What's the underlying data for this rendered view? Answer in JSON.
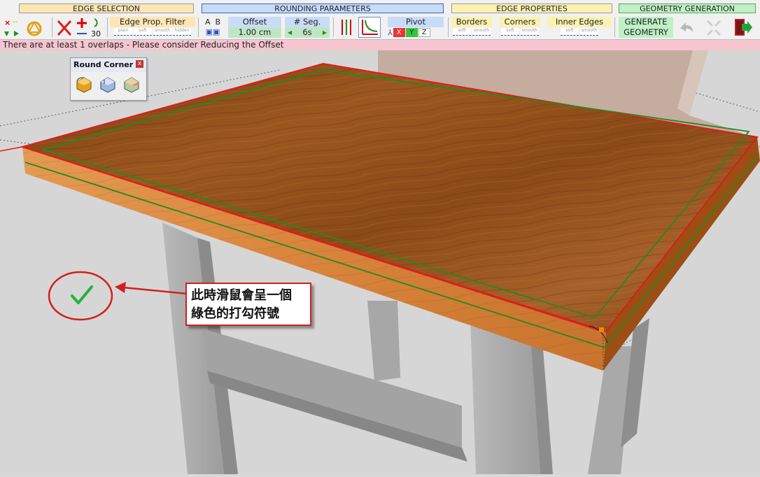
{
  "sections": {
    "edge_selection": "EDGE SELECTION",
    "rounding_parameters": "ROUNDING PARAMETERS",
    "edge_properties": "EDGE PROPERTIES",
    "geometry_generation": "GEOMETRY GENERATION"
  },
  "toolbar": {
    "angle_value": "30",
    "edge_prop_filter": "Edge Prop. Filter",
    "filter_options": [
      "plain",
      "soft",
      "smooth",
      "hidden"
    ],
    "ab_a": "A",
    "ab_b": "B",
    "offset_label": "Offset",
    "offset_value": "1.00 cm",
    "seg_label": "# Seg.",
    "seg_value": "6s",
    "pivot_label": "Pivot",
    "pivot_x": "X",
    "pivot_y": "Y",
    "pivot_z": "Z",
    "borders_label": "Borders",
    "corners_label": "Corners",
    "inner_edges_label": "Inner Edges",
    "prop_options": [
      "soft",
      "smooth"
    ],
    "generate_line1": "GENERATE",
    "generate_line2": "GEOMETRY"
  },
  "status_message": "There are at least 1 overlaps - Please consider Reducing the Offset",
  "palette": {
    "title": "Round Corner",
    "close": "x"
  },
  "callout": {
    "line1": "此時滑鼠會呈一個",
    "line2": "綠色的打勾符號"
  },
  "colors": {
    "edge_selection_bg": "#fde6b3",
    "rounding_bg": "#c9dcf7",
    "edge_props_bg": "#fbf2b2",
    "geometry_bg": "#bff0c6",
    "status_bg": "#f6c5d0",
    "selection_red": "#e11b1b",
    "offset_green": "#1f8c1f"
  },
  "icons": [
    "delete-selection-icon",
    "move-icon",
    "round-corner-icon",
    "bevel-icon",
    "chamfer-icon",
    "undo-icon",
    "exit-icon",
    "check-mark-icon"
  ]
}
